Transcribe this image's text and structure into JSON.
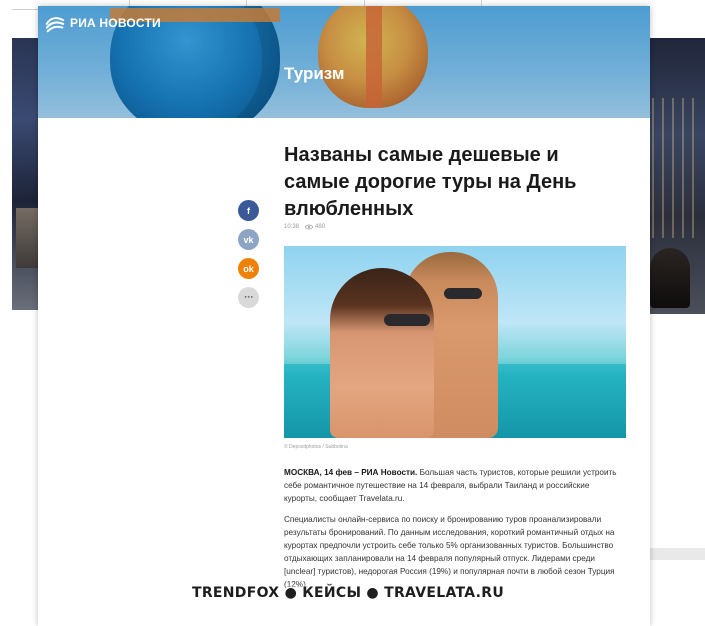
{
  "brand": {
    "logo_text": "РИА НОВОСТИ"
  },
  "section": {
    "title": "Туризм"
  },
  "article": {
    "headline": "Названы самые дешевые и самые дорогие туры на День влюбленных",
    "meta_time": "10:38",
    "meta_views": "480",
    "photo_caption": "© Depositphotos / Subbotina",
    "lead_label": "МОСКВА, 14 фев – РИА Новости.",
    "lead_text": " Большая часть туристов, которые решили устроить себе романтичное путешествие на 14 февраля, выбрали Таиланд и российские курорты, сообщает Travelata.ru.",
    "paragraph_2": "Специалисты онлайн-сервиса по поиску и бронированию туров проанализировали результаты бронирований. По данным исследования, короткий романтичный отдых на курортах предпочли устроить себе только 5% организованных туристов. Большинство отдыхающих запланировали на 14 февраля популярный отпуск. Лидерами среди [unclear] туристов), недорогая Россия (19%) и популярная почти в любой сезон Турция (12%)."
  },
  "social": {
    "fb": "f",
    "vk": "vk",
    "ok": "ok",
    "more": "⋯"
  },
  "colors": {
    "facebook": "#3b5998",
    "vk": "#8da4c4",
    "odnoklassniki": "#ee8208"
  },
  "watermark": "TRENDFOX ● КЕЙСЫ ● TRAVELATA.RU"
}
